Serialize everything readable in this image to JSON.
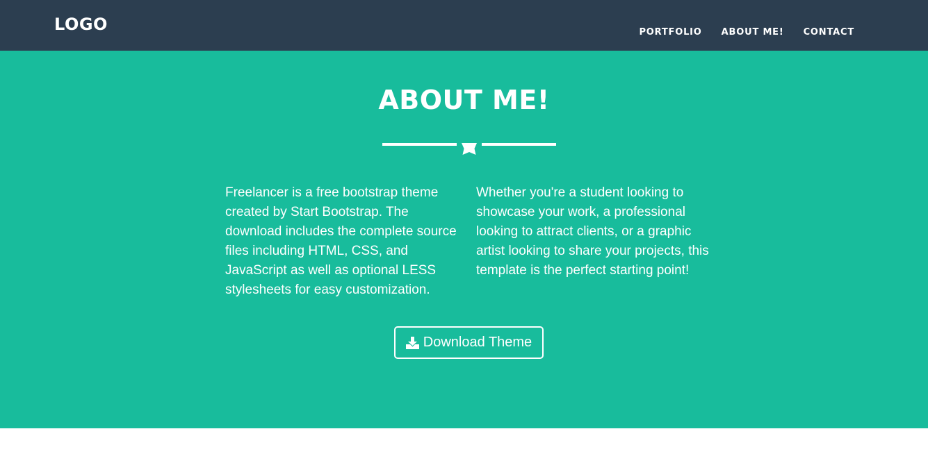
{
  "navbar": {
    "logo": "LOGO",
    "links": [
      "PORTFOLIO",
      "ABOUT ME!",
      "CONTACT"
    ]
  },
  "about": {
    "title": "ABOUT ME!",
    "left_text": "Freelancer is a free bootstrap theme created by Start Bootstrap. The download includes the complete source files including HTML, CSS, and JavaScript as well as optional LESS stylesheets for easy customization.",
    "right_text": "Whether you're a student looking to showcase your work, a professional looking to attract clients, or a graphic artist looking to share your projects, this template is the perfect starting point!",
    "download_label": "Download Theme",
    "icons": {
      "divider": "star-icon",
      "download": "download-icon"
    }
  },
  "colors": {
    "navbar_bg": "#2c3e50",
    "accent_bg": "#18bc9c",
    "text": "#ffffff"
  }
}
